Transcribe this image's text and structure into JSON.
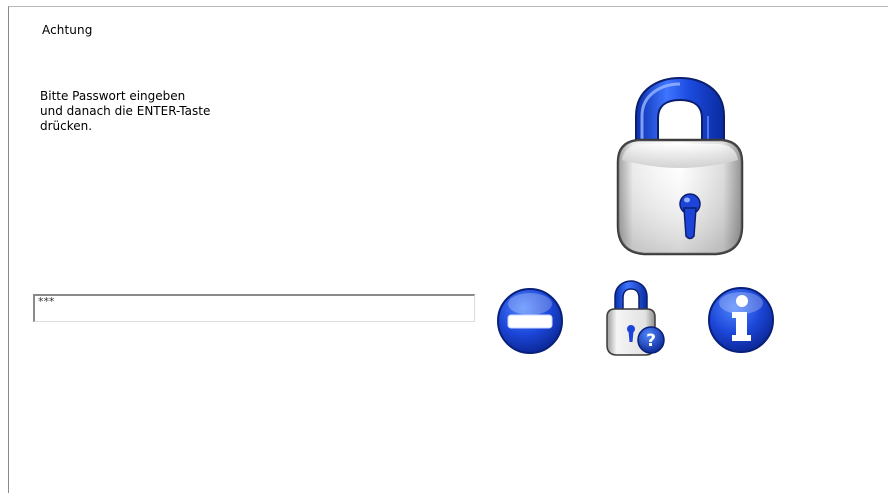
{
  "dialog": {
    "title": "Achtung",
    "message_lines": [
      "Bitte Passwort eingeben",
      "und danach die ENTER-Taste",
      "drücken."
    ]
  },
  "password_field": {
    "value": "***",
    "placeholder": ""
  },
  "icons": {
    "main": "padlock-icon",
    "cancel": "minus-circle-icon",
    "lock_help": "padlock-question-icon",
    "info": "info-circle-icon"
  },
  "colors": {
    "accent_blue": "#1b44d6",
    "lock_silver": "#e6e6e6"
  }
}
